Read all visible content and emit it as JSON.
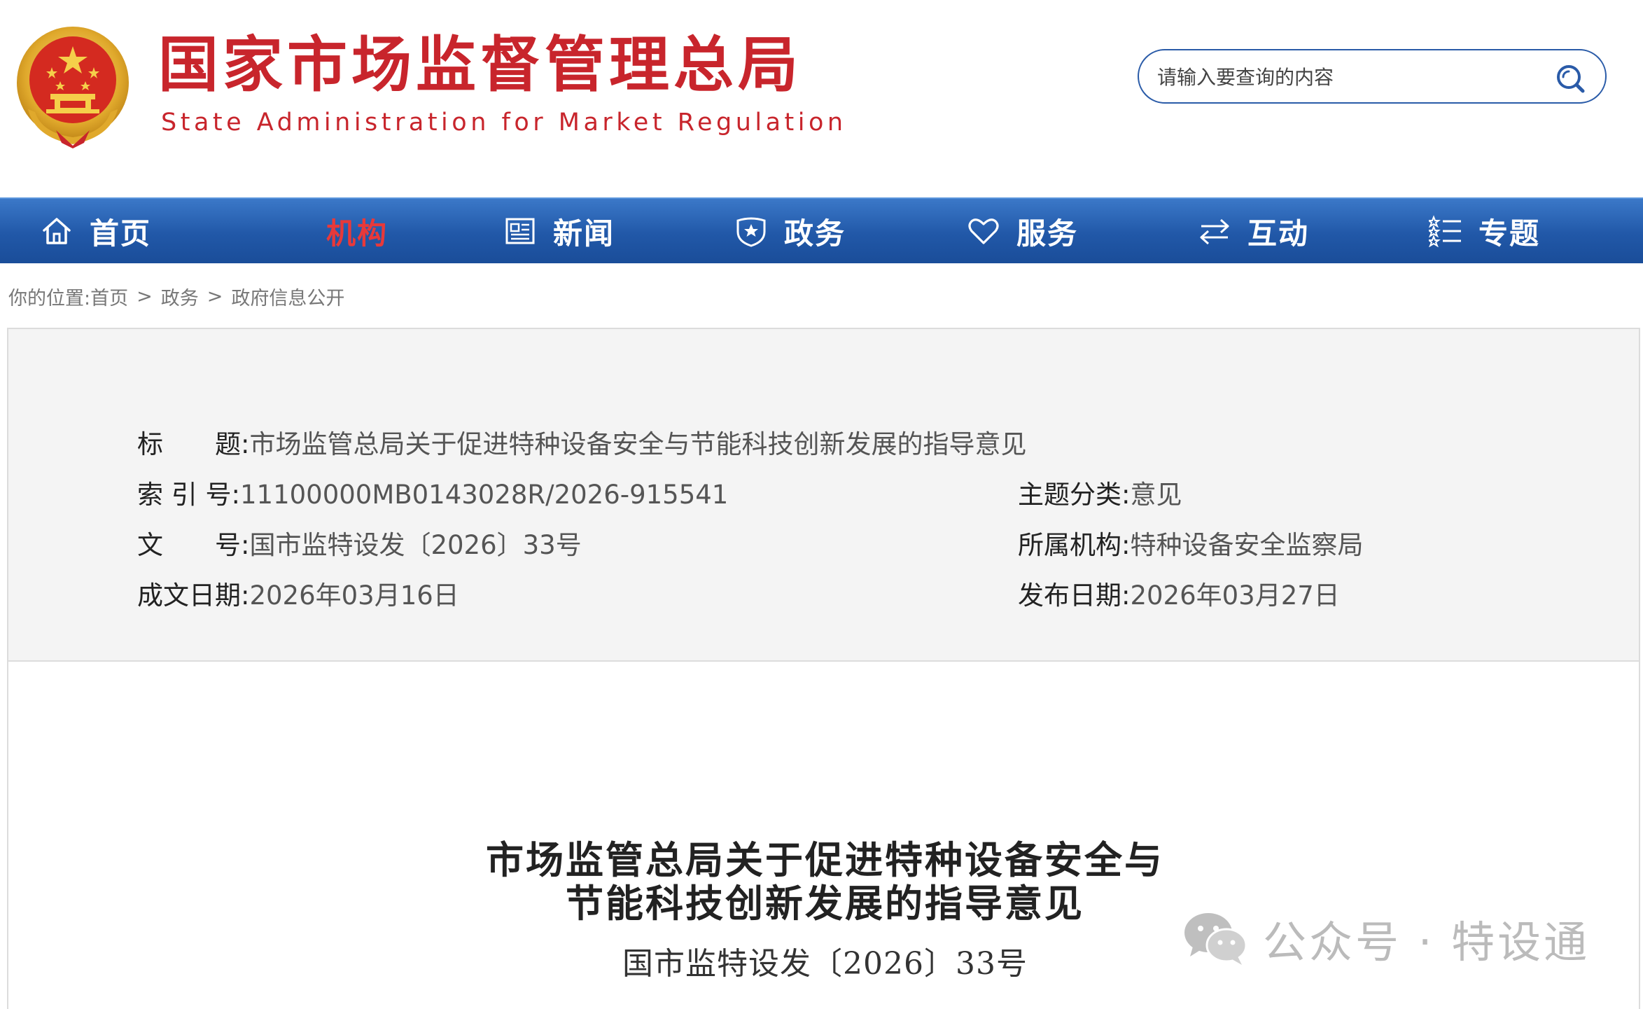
{
  "site": {
    "title_cn": "国家市场监督管理总局",
    "title_en": "State Administration for Market Regulation",
    "brand_color": "#c8252c"
  },
  "search": {
    "placeholder": "请输入要查询的内容",
    "value": ""
  },
  "nav": {
    "items": [
      {
        "label": "首页",
        "icon": "home-icon",
        "active": false
      },
      {
        "label": "机构",
        "icon": "",
        "active": true
      },
      {
        "label": "新闻",
        "icon": "news-icon",
        "active": false
      },
      {
        "label": "政务",
        "icon": "shield-icon",
        "active": false
      },
      {
        "label": "服务",
        "icon": "heart-icon",
        "active": false
      },
      {
        "label": "互动",
        "icon": "exchange-icon",
        "active": false
      },
      {
        "label": "专题",
        "icon": "list-icon",
        "active": false
      }
    ],
    "bg_color": "#2158a8",
    "active_color": "#e8393a"
  },
  "breadcrumb": {
    "prefix": "你的位置:",
    "items": [
      "首页",
      "政务",
      "政府信息公开"
    ],
    "separator": ">"
  },
  "meta": {
    "title_label": "标　　题:",
    "title_value": "市场监管总局关于促进特种设备安全与节能科技创新发展的指导意见",
    "index_label": "索 引 号:",
    "index_value": "11100000MB0143028R/2026-915541",
    "topic_label": "主题分类:",
    "topic_value": "意见",
    "docno_label": "文　　号:",
    "docno_value": "国市监特设发〔2026〕33号",
    "org_label": "所属机构:",
    "org_value": "特种设备安全监察局",
    "written_label": "成文日期:",
    "written_value": "2026年03月16日",
    "published_label": "发布日期:",
    "published_value": "2026年03月27日"
  },
  "document": {
    "title_line1": "市场监管总局关于促进特种设备安全与",
    "title_line2": "节能科技创新发展的指导意见",
    "number": "国市监特设发〔2026〕33号"
  },
  "watermark": {
    "text": "公众号 · 特设通",
    "icon": "wechat-icon"
  }
}
